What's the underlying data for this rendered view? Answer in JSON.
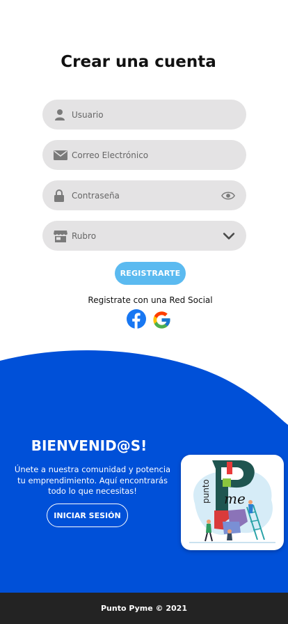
{
  "form": {
    "title": "Crear una cuenta",
    "fields": [
      {
        "placeholder": "Usuario",
        "icon": "user-icon"
      },
      {
        "placeholder": "Correo Electrónico",
        "icon": "envelope-icon"
      },
      {
        "placeholder": "Contraseña",
        "icon": "lock-icon",
        "trailing_icon": "eye-icon"
      },
      {
        "placeholder": "Rubro",
        "icon": "store-icon",
        "trailing_icon": "chevron-down-icon"
      }
    ],
    "register_label": "REGISTRARTE",
    "social_label": "Registrate con una Red Social",
    "social": [
      "facebook-icon",
      "google-icon"
    ]
  },
  "welcome": {
    "title": "BIENVENID@S!",
    "lines": [
      "Únete a nuestra comunidad y potencia",
      "tu emprendimiento. Aquí encontrarás",
      "todo lo que necesitas!"
    ],
    "login_label": "INICIAR SESIÓN",
    "logo": {
      "word1": "punto",
      "word2": "me"
    }
  },
  "footer": {
    "text": "Punto Pyme © 2021"
  },
  "colors": {
    "field_bg": "#e4e3e4",
    "register_button": "#5bbaf0",
    "panel_blue": "#0050d8",
    "footer_bg": "#232323",
    "facebook": "#1877f2"
  }
}
